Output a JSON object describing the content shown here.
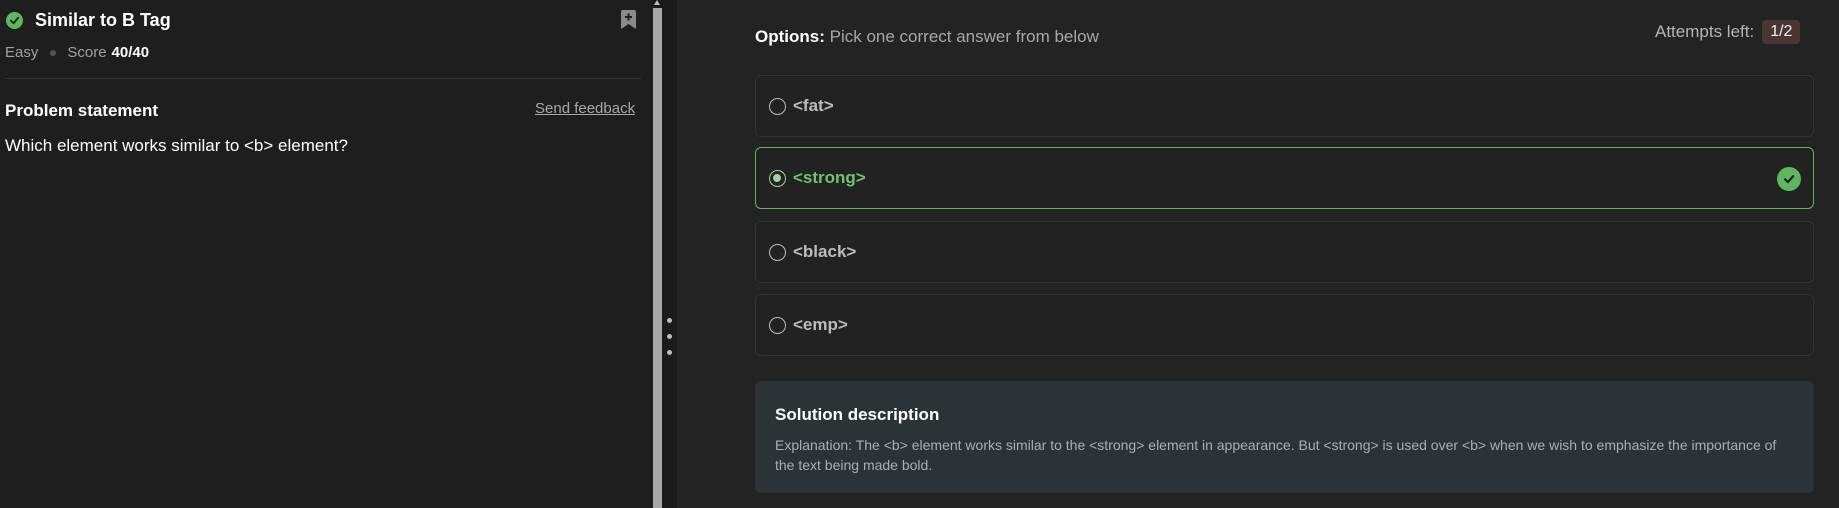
{
  "problem": {
    "title": "Similar to B Tag",
    "difficulty": "Easy",
    "score_label": "Score",
    "score_value": "40/40",
    "statement_heading": "Problem statement",
    "feedback_link": "Send feedback",
    "question": "Which element works similar to <b> element?"
  },
  "options_panel": {
    "label": "Options:",
    "sublabel": "Pick one correct answer from below",
    "attempts_label": "Attempts left:",
    "attempts_value": "1/2",
    "options": [
      {
        "text": "<fat>",
        "selected": false
      },
      {
        "text": "<strong>",
        "selected": true,
        "correct": true
      },
      {
        "text": "<black>",
        "selected": false
      },
      {
        "text": "<emp>",
        "selected": false
      }
    ]
  },
  "solution": {
    "title": "Solution description",
    "text": "Explanation: The <b> element works similar to the <strong> element in appearance. But <strong> is used over <b> when we wish to emphasize the importance of the text being made bold."
  },
  "colors": {
    "success": "#5cb85c",
    "selected_text": "#6ec46e",
    "attempts_pill": "#4a3434",
    "solution_bg": "#2c3336"
  },
  "icons": [
    "check-circle-icon",
    "bookmark-add-icon",
    "radio-icon",
    "checkmark-icon",
    "drag-handle-icon"
  ]
}
